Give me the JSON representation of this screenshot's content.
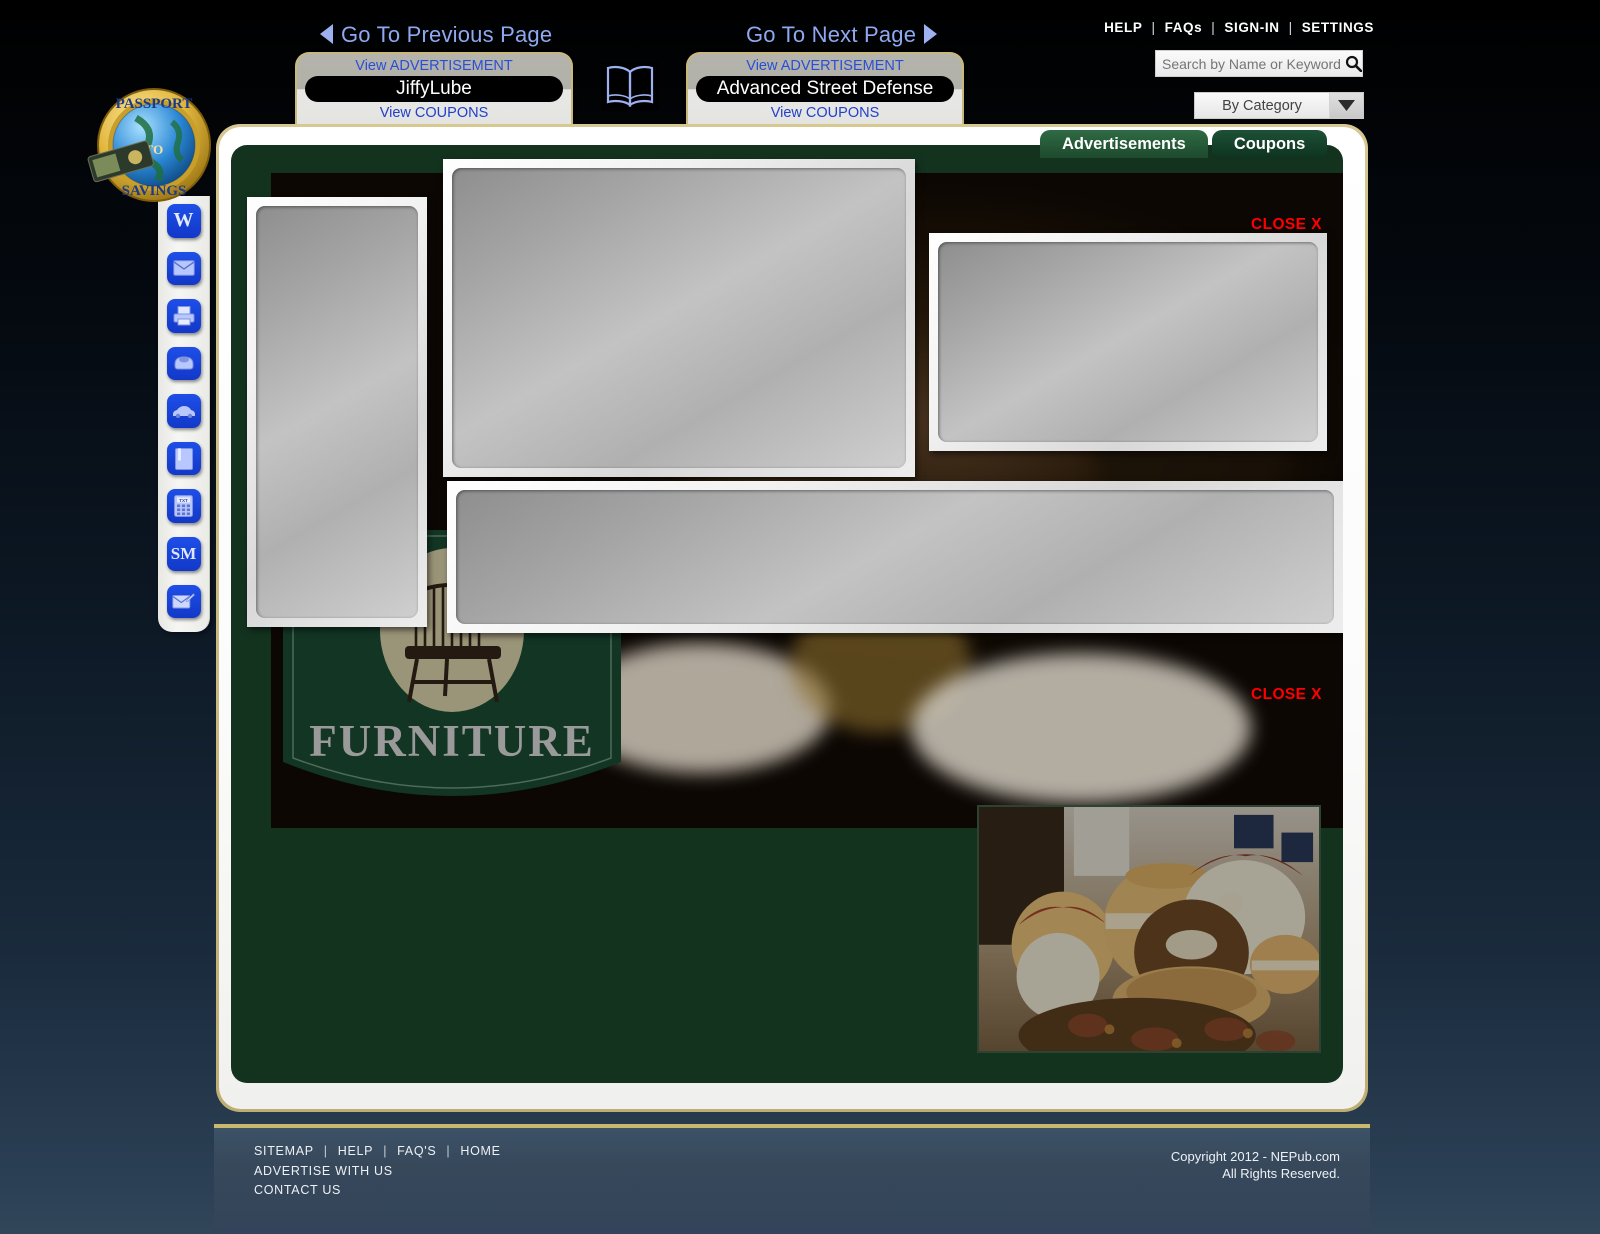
{
  "site": {
    "logo_text_top": "PASSPORT",
    "logo_text_mid": "TO",
    "logo_text_bottom": "SAVINGS"
  },
  "header": {
    "prev_page": "Go To Previous Page",
    "next_page": "Go To Next Page",
    "book_icon": "open-book-icon",
    "ad_left": {
      "view_ad": "View ADVERTISEMENT",
      "advertiser": "JiffyLube",
      "view_coupons": "View COUPONS"
    },
    "ad_right": {
      "view_ad": "View ADVERTISEMENT",
      "advertiser": "Advanced Street Defense",
      "view_coupons": "View COUPONS"
    },
    "util_nav": [
      "HELP",
      "FAQs",
      "SIGN-IN",
      "SETTINGS"
    ],
    "util_sep": "|",
    "search": {
      "placeholder": "Search by Name or Keyword",
      "value": "",
      "icon": "search-icon"
    },
    "category": {
      "selected": "By Category",
      "caret": "chevron-down-icon"
    }
  },
  "tabs": [
    {
      "id": "advertisements",
      "label": "Advertisements",
      "active": true
    },
    {
      "id": "coupons",
      "label": "Coupons",
      "active": false
    }
  ],
  "sidebar": {
    "items": [
      {
        "name": "website-icon",
        "glyph": "W"
      },
      {
        "name": "email-icon",
        "glyph": "✉"
      },
      {
        "name": "printer-icon",
        "glyph": "⎙"
      },
      {
        "name": "phone-icon",
        "glyph": "☎"
      },
      {
        "name": "directions-car-icon",
        "glyph": "▰"
      },
      {
        "name": "bookmark-icon",
        "glyph": "▮"
      },
      {
        "name": "text-calculator-icon",
        "glyph": "TXT"
      },
      {
        "name": "social-media-icon",
        "glyph": "SM"
      },
      {
        "name": "contact-mail-icon",
        "glyph": "✉"
      }
    ]
  },
  "main": {
    "background_ad": {
      "brand": "FURNITURE",
      "emblem": "windsor-chair-icon"
    },
    "close_labels": {
      "top": "CLOSE X",
      "bottom": "CLOSE X"
    },
    "placeholders": [
      {
        "name": "ad-image-tall",
        "status": "empty"
      },
      {
        "name": "ad-image-main",
        "status": "empty"
      },
      {
        "name": "ad-image-right",
        "status": "empty"
      },
      {
        "name": "ad-image-wide",
        "status": "empty"
      }
    ],
    "product_photo": "autumn-pottery-display-photo"
  },
  "footer": {
    "links_row1": [
      "SITEMAP",
      "HELP",
      "FAQ'S",
      "HOME"
    ],
    "separator": "|",
    "link_advertise": "ADVERTISE WITH US",
    "link_contact": "CONTACT US",
    "copyright": "Copyright 2012 - NEPub.com",
    "rights": "All Rights Reserved."
  },
  "colors": {
    "panel_green": "#13331f",
    "gold_border": "#c9b96f",
    "link_blue": "#2a4fd6",
    "close_red": "#ff0000",
    "tab_active": "#2f6b44",
    "footer_bg": "#35475b"
  }
}
